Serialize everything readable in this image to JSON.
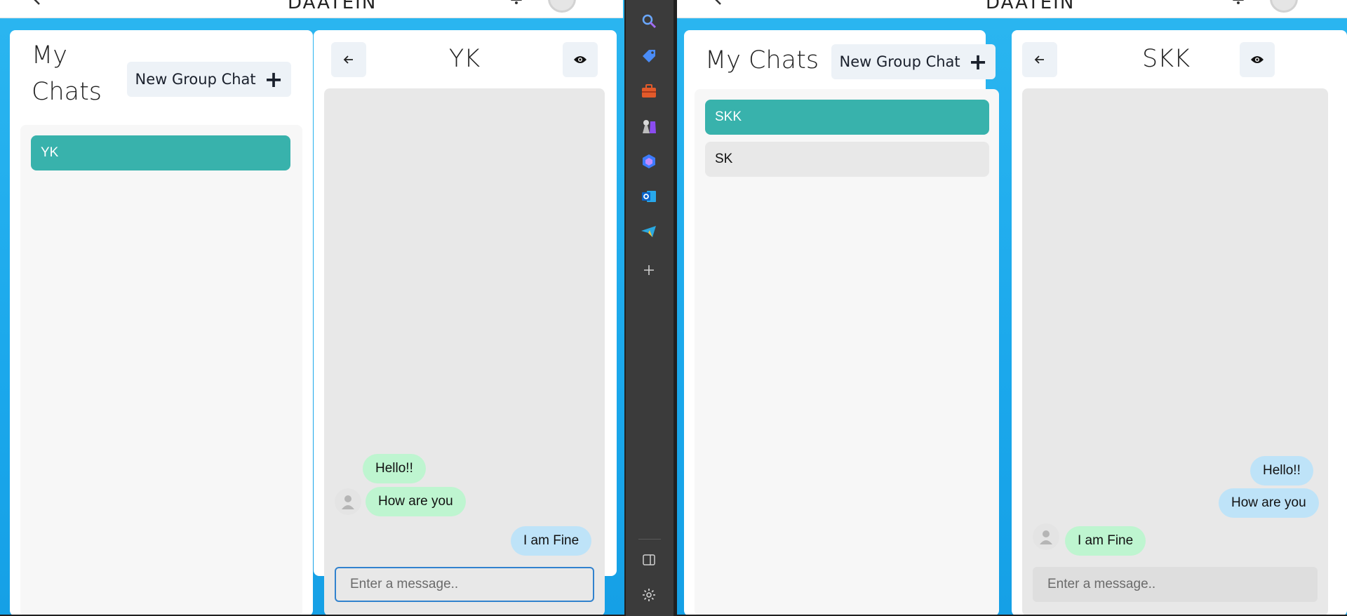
{
  "left_window": {
    "topbar": {
      "title": "DAATEIN"
    },
    "sidebar": {
      "title": "My Chats",
      "new_group_label": "New Group Chat",
      "chats": [
        {
          "name": "YK",
          "selected": true
        }
      ]
    },
    "conversation": {
      "title": "YK",
      "messages": [
        {
          "text": "Hello!!",
          "sender": "other"
        },
        {
          "text": "How are you",
          "sender": "other",
          "show_avatar": true
        },
        {
          "text": "I am Fine",
          "sender": "me"
        }
      ],
      "input": {
        "placeholder": "Enter a message..",
        "value": ""
      }
    }
  },
  "right_window": {
    "topbar": {
      "title": "DAATEIN"
    },
    "sidebar": {
      "title": "My Chats",
      "new_group_label": "New Group Chat",
      "chats": [
        {
          "name": "SKK",
          "selected": true
        },
        {
          "name": "SK",
          "selected": false
        }
      ]
    },
    "conversation": {
      "title": "SKK",
      "messages": [
        {
          "text": "Hello!!",
          "sender": "me"
        },
        {
          "text": "How are you",
          "sender": "me"
        },
        {
          "text": "I am Fine",
          "sender": "other",
          "show_avatar": true
        }
      ],
      "input": {
        "placeholder": "Enter a message..",
        "value": ""
      }
    }
  },
  "edge_sidebar": {
    "items": [
      "search-icon",
      "shopping-tag-icon",
      "tools-icon",
      "games-icon",
      "copilot-icon",
      "outlook-icon",
      "telegram-icon",
      "add-icon"
    ],
    "bottom": [
      "sidebar-toggle-icon",
      "settings-icon"
    ]
  },
  "colors": {
    "accent": "#38b2ac",
    "bubble_other": "#bef5d0",
    "bubble_me": "#bee3f8",
    "background": "#1ba8ec",
    "focus_border": "#3182ce"
  }
}
